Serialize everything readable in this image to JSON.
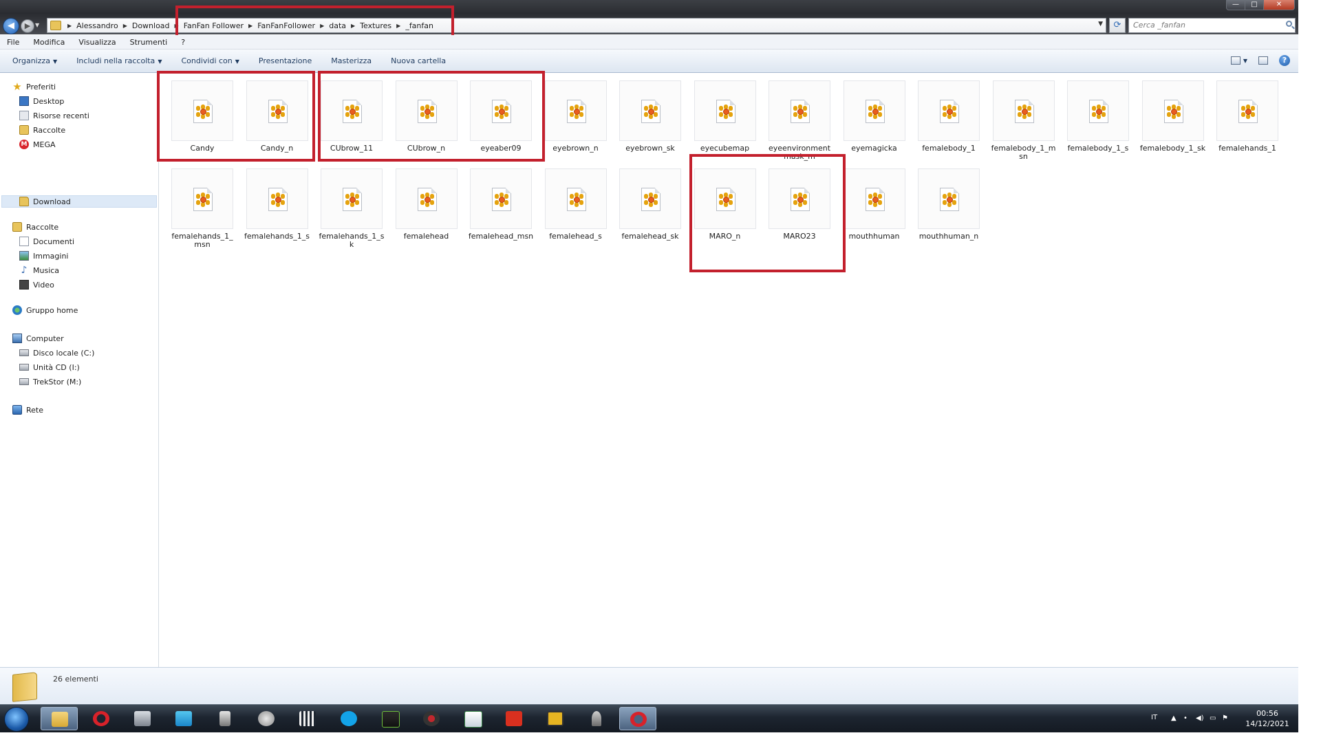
{
  "window": {
    "min_symbol": "—",
    "max_symbol": "□",
    "close_symbol": "✕"
  },
  "address": {
    "breadcrumbs": [
      "Alessandro",
      "Download",
      "FanFan Follower",
      "FanFanFollower",
      "data",
      "Textures",
      "_fanfan"
    ],
    "search_placeholder": "Cerca _fanfan"
  },
  "menubar": {
    "items": [
      "File",
      "Modifica",
      "Visualizza",
      "Strumenti",
      "?"
    ]
  },
  "commandbar": {
    "organize": "Organizza",
    "include": "Includi nella raccolta",
    "share": "Condividi con",
    "slideshow": "Presentazione",
    "burn": "Masterizza",
    "new_folder": "Nuova cartella",
    "help_glyph": "?"
  },
  "sidebar": {
    "favorites": {
      "label": "Preferiti",
      "items": [
        "Desktop",
        "Risorse recenti",
        "Raccolte",
        "MEGA",
        "Download"
      ]
    },
    "libraries": {
      "label": "Raccolte",
      "items": [
        "Documenti",
        "Immagini",
        "Musica",
        "Video"
      ]
    },
    "homegroup": "Gruppo home",
    "computer": {
      "label": "Computer",
      "items": [
        "Disco locale (C:)",
        "Unità CD (I:)",
        "TrekStor (M:)"
      ]
    },
    "network": "Rete"
  },
  "files": [
    "Candy",
    "Candy_n",
    "CUbrow_11",
    "CUbrow_n",
    "eyeaber09",
    "eyebrown_n",
    "eyebrown_sk",
    "eyecubemap",
    "eyeenvironmentmask_m",
    "eyemagicka",
    "femalebody_1",
    "femalebody_1_msn",
    "femalebody_1_s",
    "femalebody_1_sk",
    "femalehands_1",
    "femalehands_1_msn",
    "femalehands_1_s",
    "femalehands_1_sk",
    "femalehead",
    "femalehead_msn",
    "femalehead_s",
    "femalehead_sk",
    "MARO_n",
    "MARO23",
    "mouthhuman",
    "mouthhuman_n"
  ],
  "status": {
    "count": "26 elementi"
  },
  "taskbar": {
    "language": "IT",
    "time": "00:56",
    "date": "14/12/2021"
  },
  "colors": {
    "highlight_box": "#c3202d",
    "taskbar": "#1d2530",
    "selection": "#dde9f7"
  }
}
